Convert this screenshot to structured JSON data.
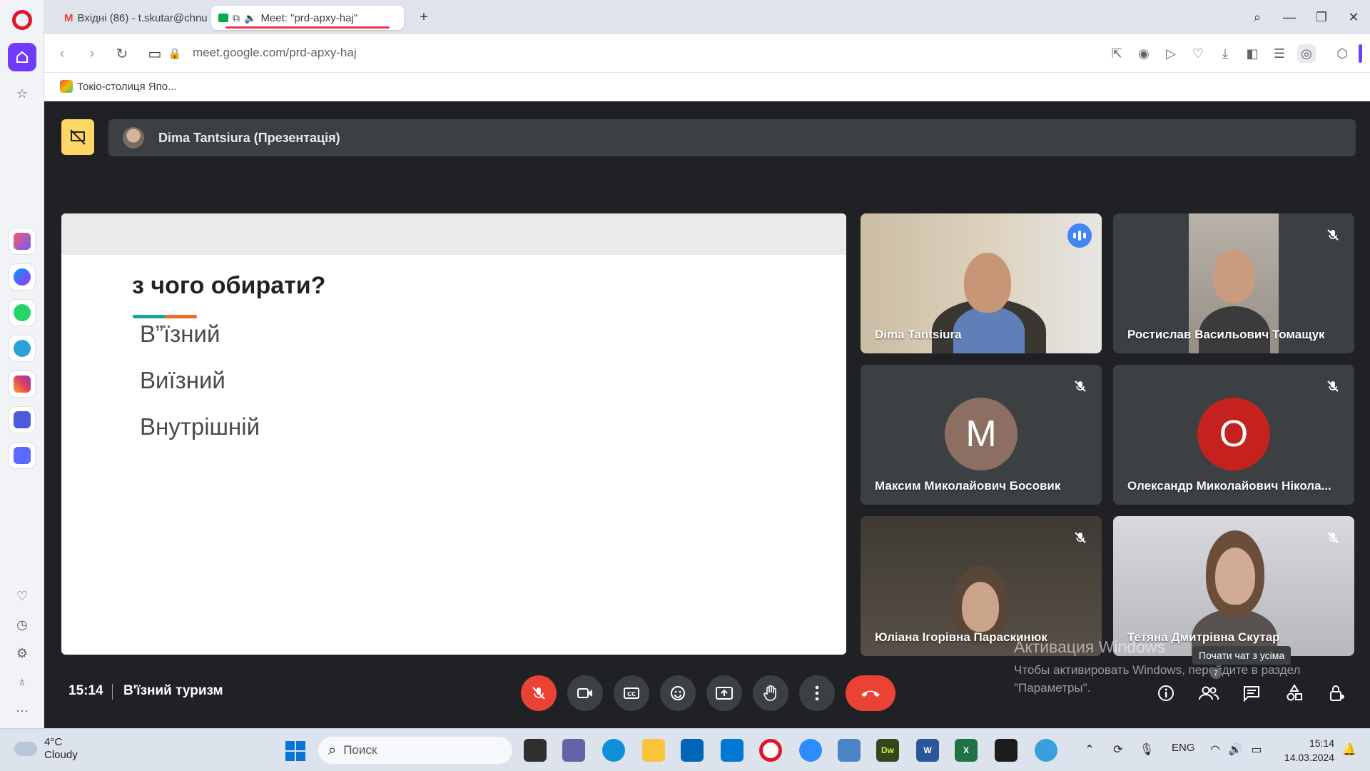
{
  "browser": {
    "tabs": [
      {
        "label": "Вхідні (86) - t.skutar@chnu"
      },
      {
        "label": "Meet: \"prd-apxy-haj\""
      }
    ],
    "url": "meet.google.com/prd-apxy-haj",
    "bookmark": "Токіо-столиця Япо..."
  },
  "meet": {
    "presenter_banner": "Dima Tantsiura (Презентація)",
    "slide": {
      "title": "з чого обирати?",
      "items": [
        "В”їзний",
        "Виїзний",
        "Внутрішній"
      ]
    },
    "participants": [
      {
        "name": "Dima Tantsiura",
        "speaking": true
      },
      {
        "name": "Ростислав Васильович Томащук",
        "muted": true
      },
      {
        "name": "Максим Миколайович Босовик",
        "muted": true,
        "initial": "M",
        "color": "#8d6e63"
      },
      {
        "name": "Олександр Миколайович Нікола...",
        "muted": true,
        "initial": "O",
        "color": "#c5221f"
      },
      {
        "name": "Юліана Ігорівна Параскинюк",
        "muted": true
      },
      {
        "name": "Тетяна Дмитрівна Скутар",
        "muted": true
      }
    ],
    "time": "15:14",
    "meeting_title": "В'їзний туризм",
    "chat_tooltip": "Почати чат з усіма",
    "people_badge": "7",
    "watermark": {
      "line1": "Активация Windows",
      "line2": "Чтобы активировать Windows, перейдите в раздел \"Параметры\"."
    }
  },
  "taskbar": {
    "weather_temp": "4°C",
    "weather_desc": "Cloudy",
    "search_placeholder": "Поиск",
    "language": "ENG",
    "time": "15:14",
    "date": "14.03.2024"
  }
}
